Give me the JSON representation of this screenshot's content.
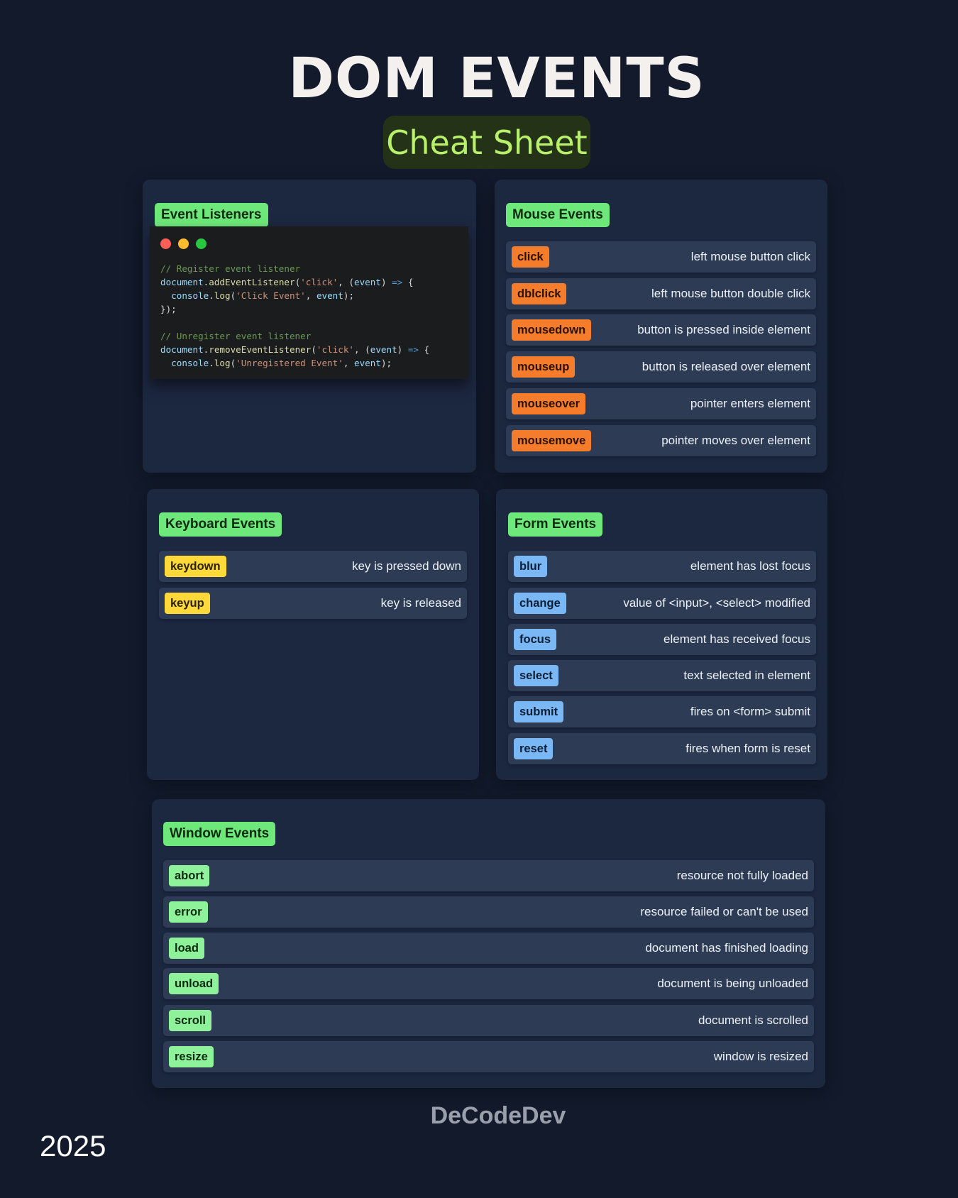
{
  "header": {
    "title": "DOM EVENTS",
    "subtitle": "Cheat Sheet"
  },
  "listeners": {
    "title": "Event Listeners",
    "code": {
      "comment1": "// Register event listener",
      "comment2": "// Unregister event listener",
      "obj": "document",
      "add_fn": "addEventListener",
      "remove_fn": "removeEventListener",
      "click_str": "'click'",
      "param": "event",
      "arrow": "=>",
      "console": "console",
      "log": "log",
      "click_event_str": "'Click Event'",
      "unreg_event_str": "'Unregistered Event'",
      "close": "});"
    }
  },
  "mouse": {
    "title": "Mouse Events",
    "items": [
      {
        "name": "click",
        "desc": "left mouse button click"
      },
      {
        "name": "dblclick",
        "desc": "left mouse button double click"
      },
      {
        "name": "mousedown",
        "desc": "button is pressed inside element"
      },
      {
        "name": "mouseup",
        "desc": "button is released over element"
      },
      {
        "name": "mouseover",
        "desc": "pointer enters element"
      },
      {
        "name": "mousemove",
        "desc": "pointer moves over element"
      }
    ]
  },
  "keyboard": {
    "title": "Keyboard Events",
    "items": [
      {
        "name": "keydown",
        "desc": "key is pressed down"
      },
      {
        "name": "keyup",
        "desc": "key is released"
      }
    ]
  },
  "form": {
    "title": "Form Events",
    "items": [
      {
        "name": "blur",
        "desc": "element has lost focus"
      },
      {
        "name": "change",
        "desc": "value of <input>, <select> modified"
      },
      {
        "name": "focus",
        "desc": "element has received focus"
      },
      {
        "name": "select",
        "desc": "text selected in element"
      },
      {
        "name": "submit",
        "desc": "fires on <form> submit"
      },
      {
        "name": "reset",
        "desc": "fires when form is reset"
      }
    ]
  },
  "window": {
    "title": "Window Events",
    "items": [
      {
        "name": "abort",
        "desc": "resource not fully loaded"
      },
      {
        "name": "error",
        "desc": "resource failed or can't be used"
      },
      {
        "name": "load",
        "desc": "document has finished loading"
      },
      {
        "name": "unload",
        "desc": "document is being unloaded"
      },
      {
        "name": "scroll",
        "desc": "document is scrolled"
      },
      {
        "name": "resize",
        "desc": "window is resized"
      }
    ]
  },
  "footer": {
    "brand": "DeCodeDev",
    "year": "2025"
  },
  "colors": {
    "background": "#121a2c",
    "card": "#1c2740",
    "section_title": "#6ee87a",
    "mouse_tag": "#f47c2a",
    "keyboard_tag": "#ffd83a",
    "form_tag": "#7ab8f5",
    "window_tag": "#8ef29a",
    "subtitle_text": "#b8f06b",
    "dot_red": "#ff5f57",
    "dot_yellow": "#febc2e",
    "dot_green": "#28c840"
  }
}
